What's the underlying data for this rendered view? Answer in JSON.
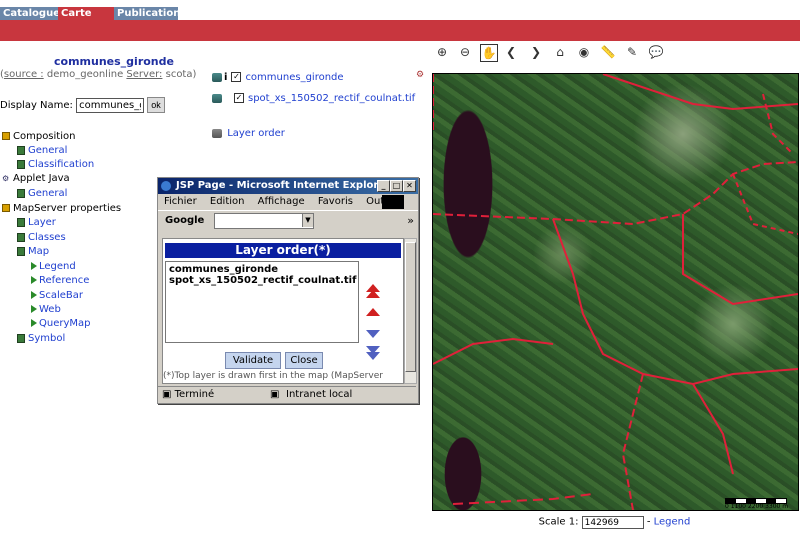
{
  "tabs": {
    "catalogue": "Catalogue",
    "carte": "Carte",
    "publication": "Publication"
  },
  "left": {
    "title": "communes_gironde",
    "source_label": "source :",
    "source_value": "demo_geonline",
    "server_label": "Server:",
    "server_value": "scota",
    "display_label": "Display Name:",
    "display_value": "communes_gironde",
    "ok_label": "ok"
  },
  "tree": {
    "composition": "Composition",
    "general": "General",
    "classification": "Classification",
    "applet": "Applet Java",
    "applet_general": "General",
    "mapserver": "MapServer properties",
    "layer": "Layer",
    "classes": "Classes",
    "map": "Map",
    "legend": "Legend",
    "reference": "Reference",
    "scalebar": "ScaleBar",
    "web": "Web",
    "querymap": "QueryMap",
    "symbol": "Symbol"
  },
  "layers": {
    "items": [
      "communes_gironde",
      "spot_xs_150502_rectif_coulnat.tif"
    ],
    "info_glyph": "i",
    "layer_order": "Layer order"
  },
  "popup": {
    "title": "JSP Page - Microsoft Internet Explorer",
    "menu": [
      "Fichier",
      "Edition",
      "Affichage",
      "Favoris",
      "Out"
    ],
    "more": "»",
    "google": "Google",
    "header": "Layer order(*)",
    "list": [
      "communes_gironde",
      "spot_xs_150502_rectif_coulnat.tif"
    ],
    "validate": "Validate",
    "close": "Close",
    "footnote": "(*)Top layer is drawn first in the map (MapServer",
    "status_left": "Terminé",
    "status_right": "Intranet local"
  },
  "map": {
    "scale_label": "Scale 1:",
    "scale_value": "142969",
    "legend_sep": "-",
    "legend_link": "Legend",
    "scalebar_text": "0  1100 2200 3300 m"
  },
  "colors": {
    "accent_red": "#c8363e",
    "tab_blue": "#6a86a8",
    "link": "#1f3fcf"
  }
}
